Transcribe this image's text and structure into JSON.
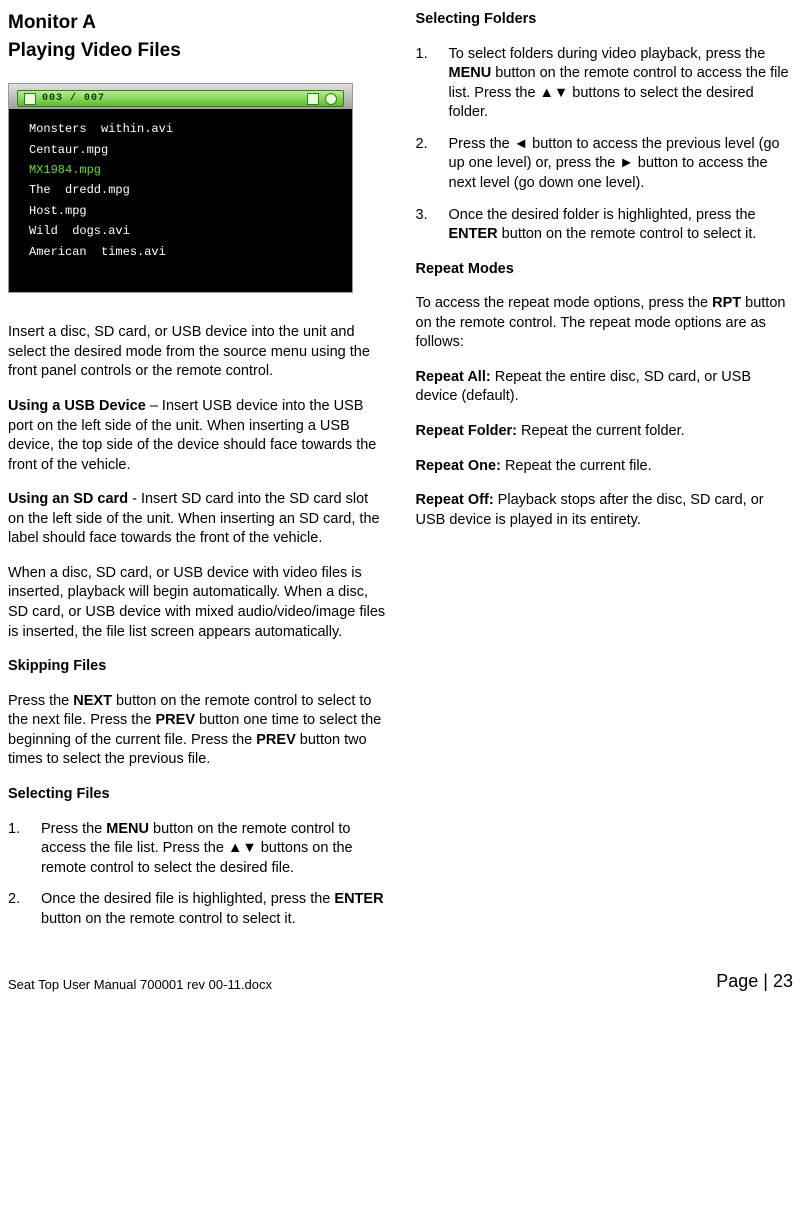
{
  "header": {
    "title": "Monitor A",
    "subtitle": "Playing Video Files"
  },
  "screenshot": {
    "counter": "003 / 007",
    "files": [
      "Monsters  within.avi",
      "Centaur.mpg",
      "MX1984.mpg",
      "The  dredd.mpg",
      "Host.mpg",
      "Wild  dogs.avi",
      "American  times.avi"
    ],
    "selected_index": 2
  },
  "left": {
    "intro": "Insert a disc, SD card, or USB device into the unit and select the desired mode from the source menu using the front panel controls or the remote control.",
    "usb_label": "Using a USB Device",
    "usb_text": " – Insert USB device into the USB port on the left side of the unit. When inserting a USB device, the top side of the device should face towards the front of the vehicle.",
    "sd_label": "Using an SD card",
    "sd_text": " - Insert SD card into the SD card slot on the left side of the unit. When inserting an SD card, the label should face towards the front of the vehicle.",
    "auto": "When a disc, SD card, or USB device with video files is inserted, playback will begin automatically. When a disc, SD card, or USB device with mixed audio/video/image files is inserted, the file list screen appears automatically.",
    "skip_head": "Skipping Files",
    "skip_p1a": "Press the ",
    "skip_next": "NEXT",
    "skip_p1b": " button on the remote control to select to the next file. Press the ",
    "skip_prev1": "PREV",
    "skip_p1c": " button one time to select the beginning of the current file. Press the ",
    "skip_prev2": "PREV",
    "skip_p1d": " button two times to select the previous file.",
    "selfile_head": "Selecting Files",
    "selfile_1a": "Press the ",
    "selfile_1_menu": "MENU",
    "selfile_1b": " button on the remote control to access the file list. Press the ▲▼ buttons on the remote control to select the desired file.",
    "selfile_2a": "Once the desired file is highlighted, press the ",
    "selfile_2_enter": "ENTER",
    "selfile_2b": " button on the remote control to select it."
  },
  "right": {
    "selfold_head": "Selecting Folders",
    "f1a": "To select folders during video playback, press the ",
    "f1_menu": "MENU",
    "f1b": " button on the remote control to access the file list. Press the ▲▼ buttons to select the desired folder.",
    "f2": "Press the ◄ button to access the previous level (go up one level) or, press the ► button to access the next level (go down one level).",
    "f3a": "Once the desired folder is highlighted, press the ",
    "f3_enter": "ENTER",
    "f3b": " button on the remote control to select it.",
    "rpt_head": "Repeat Modes",
    "rpt_intro_a": "To access the repeat mode options, press the ",
    "rpt_btn": "RPT",
    "rpt_intro_b": " button on the remote control. The repeat mode options are as follows:",
    "rall_l": "Repeat All:",
    "rall_t": " Repeat the entire disc, SD card, or USB device (default).",
    "rfold_l": "Repeat Folder:",
    "rfold_t": " Repeat the current folder.",
    "rone_l": "Repeat One:",
    "rone_t": " Repeat the current file.",
    "roff_l": "Repeat Off:",
    "roff_t": " Playback stops after the disc, SD card, or USB device is played in its entirety."
  },
  "footer": {
    "doc": "Seat Top User Manual 700001 rev 00-11.docx",
    "page": "Page | 23"
  },
  "list_numbers": {
    "n1": "1.",
    "n2": "2.",
    "n3": "3."
  }
}
